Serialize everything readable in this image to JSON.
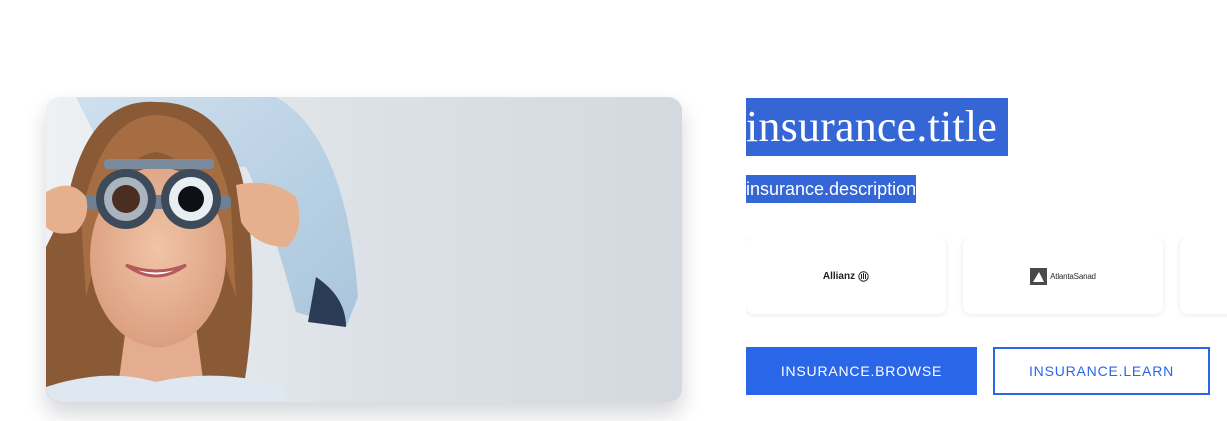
{
  "insurance": {
    "title": "insurance.title",
    "description": "insurance.description",
    "browse_label": "INSURANCE.BROWSE",
    "learn_label": "INSURANCE.LEARN"
  },
  "hero_image": {
    "subject": "woman-eye-exam-trial-frame-photo"
  },
  "partners": [
    {
      "name": "Allianz",
      "icon": "allianz-logo"
    },
    {
      "name": "AtlantaSanad",
      "icon": "atlantasanad-logo"
    },
    {
      "name": "",
      "icon": "partner-logo"
    }
  ],
  "colors": {
    "accent": "#2a66e8",
    "highlight": "#3566d6",
    "text_on_accent": "#ffffff"
  }
}
